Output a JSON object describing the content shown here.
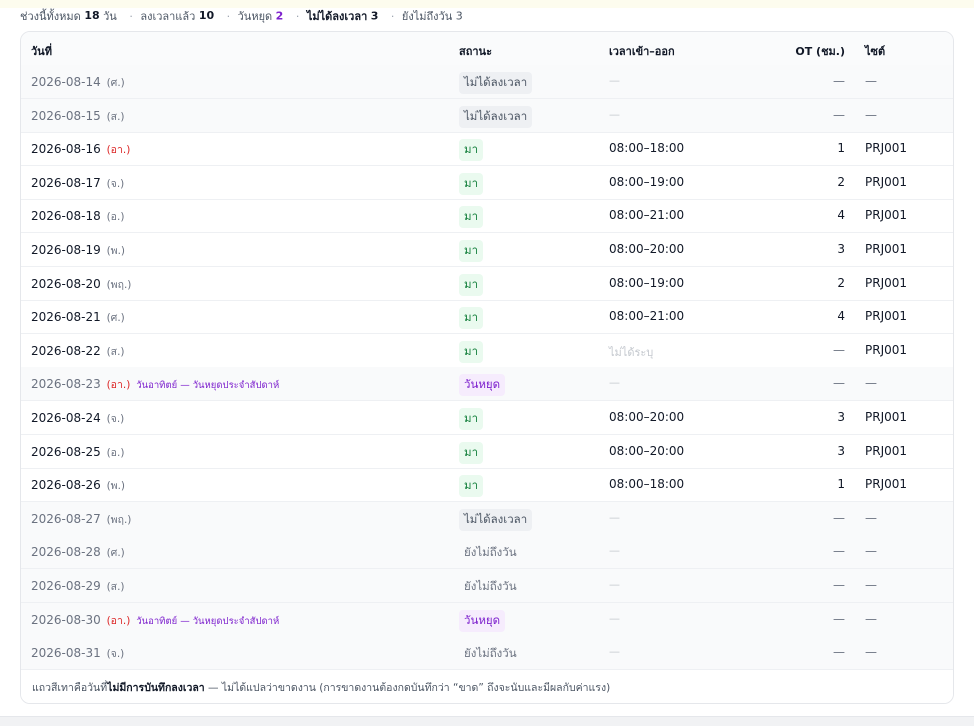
{
  "summary": {
    "range_label": "ช่วงนี้ทั้งหมด",
    "range_count": "18",
    "range_unit": "วัน",
    "clocked_label": "ลงเวลาแล้ว",
    "clocked_count": "10",
    "holiday_label": "วันหยุด",
    "holiday_count": "2",
    "missing_label": "ไม่ได้ลงเวลา",
    "missing_count": "3",
    "future_label": "ยังไม่ถึงวัน",
    "future_count": "3",
    "separator": "·"
  },
  "table": {
    "headers": {
      "date": "วันที่",
      "status": "สถานะ",
      "time": "เวลาเข้า–ออก",
      "ot": "OT (ชม.)",
      "site": "ไซต์"
    },
    "rows": [
      {
        "date": "2026-08-14",
        "dow": "(ศ.)",
        "status": "ไม่ได้ลงเวลา",
        "time": "—",
        "ot": "—",
        "site": "—"
      },
      {
        "date": "2026-08-15",
        "dow": "(ส.)",
        "status": "ไม่ได้ลงเวลา",
        "time": "—",
        "ot": "—",
        "site": "—"
      },
      {
        "date": "2026-08-16",
        "dow": "(อา.)",
        "status": "มา",
        "time": "08:00–18:00",
        "ot": "1",
        "site": "PRJ001"
      },
      {
        "date": "2026-08-17",
        "dow": "(จ.)",
        "status": "มา",
        "time": "08:00–19:00",
        "ot": "2",
        "site": "PRJ001"
      },
      {
        "date": "2026-08-18",
        "dow": "(อ.)",
        "status": "มา",
        "time": "08:00–21:00",
        "ot": "4",
        "site": "PRJ001"
      },
      {
        "date": "2026-08-19",
        "dow": "(พ.)",
        "status": "มา",
        "time": "08:00–20:00",
        "ot": "3",
        "site": "PRJ001"
      },
      {
        "date": "2026-08-20",
        "dow": "(พฤ.)",
        "status": "มา",
        "time": "08:00–19:00",
        "ot": "2",
        "site": "PRJ001"
      },
      {
        "date": "2026-08-21",
        "dow": "(ศ.)",
        "status": "มา",
        "time": "08:00–21:00",
        "ot": "4",
        "site": "PRJ001"
      },
      {
        "date": "2026-08-22",
        "dow": "(ส.)",
        "status": "มา",
        "time": "ไม่ได้ระบุ",
        "ot": "—",
        "site": "PRJ001"
      },
      {
        "date": "2026-08-23",
        "dow": "(อา.)",
        "holiday": "วันอาทิตย์ — วันหยุดประจำสัปดาห์",
        "status": "วันหยุด",
        "time": "—",
        "ot": "—",
        "site": "—"
      },
      {
        "date": "2026-08-24",
        "dow": "(จ.)",
        "status": "มา",
        "time": "08:00–20:00",
        "ot": "3",
        "site": "PRJ001"
      },
      {
        "date": "2026-08-25",
        "dow": "(อ.)",
        "status": "มา",
        "time": "08:00–20:00",
        "ot": "3",
        "site": "PRJ001"
      },
      {
        "date": "2026-08-26",
        "dow": "(พ.)",
        "status": "มา",
        "time": "08:00–18:00",
        "ot": "1",
        "site": "PRJ001"
      },
      {
        "date": "2026-08-27",
        "dow": "(พฤ.)",
        "status": "ไม่ได้ลงเวลา",
        "time": "—",
        "ot": "—",
        "site": "—"
      },
      {
        "date": "2026-08-28",
        "dow": "(ศ.)",
        "status": "ยังไม่ถึงวัน",
        "time": "—",
        "ot": "—",
        "site": "—"
      },
      {
        "date": "2026-08-29",
        "dow": "(ส.)",
        "status": "ยังไม่ถึงวัน",
        "time": "—",
        "ot": "—",
        "site": "—"
      },
      {
        "date": "2026-08-30",
        "dow": "(อา.)",
        "holiday": "วันอาทิตย์ — วันหยุดประจำสัปดาห์",
        "status": "วันหยุด",
        "time": "—",
        "ot": "—",
        "site": "—"
      },
      {
        "date": "2026-08-31",
        "dow": "(จ.)",
        "status": "ยังไม่ถึงวัน",
        "time": "—",
        "ot": "—",
        "site": "—"
      }
    ]
  },
  "footnote": {
    "prefix": "แถวสีเทาคือวันที่",
    "bold": "ไม่มีการบันทึกลงเวลา",
    "suffix": " — ไม่ได้แปลว่าขาดงาน (การขาดงานต้องกดบันทึกว่า “ขาด” ถึงจะนับและมีผลกับค่าแรง)"
  },
  "colors": {
    "present": "#15803d",
    "holiday": "#7e22ce",
    "sunday": "#dc2626",
    "muted_row": "#f9fafb"
  }
}
